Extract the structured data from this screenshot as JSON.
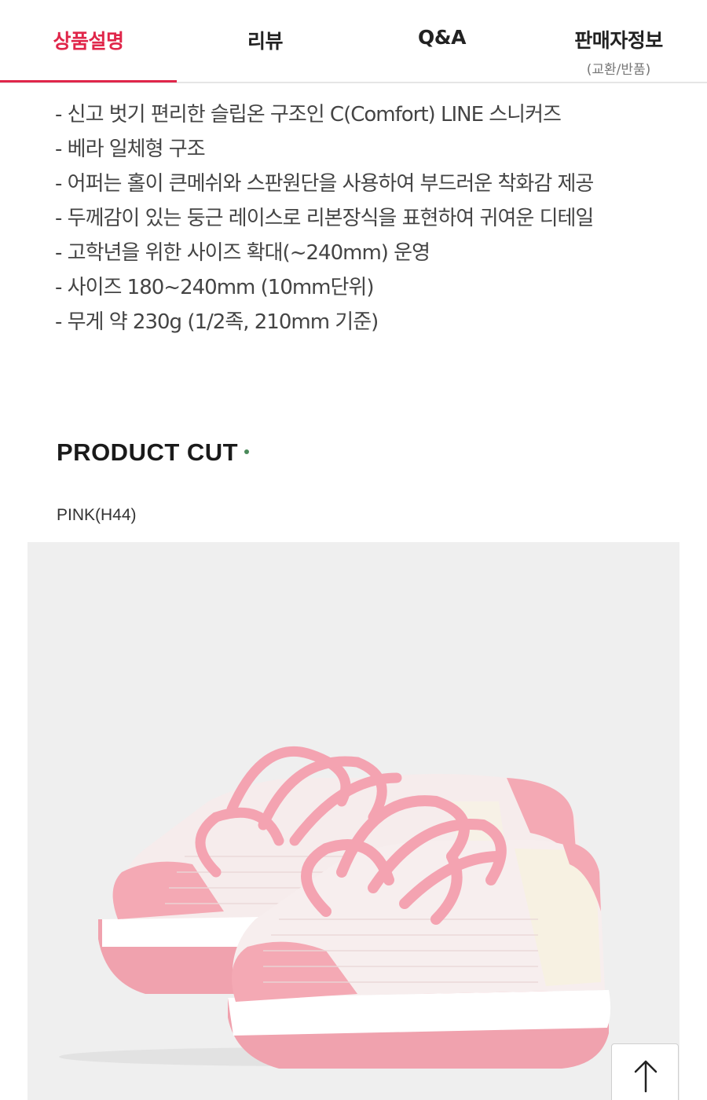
{
  "tabs": [
    {
      "label": "상품설명",
      "sub": "",
      "active": true
    },
    {
      "label": "리뷰",
      "sub": "",
      "active": false
    },
    {
      "label": "Q&A",
      "sub": "",
      "active": false
    },
    {
      "label": "판매자정보",
      "sub": "(교환/반품)",
      "active": false
    }
  ],
  "description": [
    "- 신고 벗기 편리한 슬립온 구조인 C(Comfort) LINE 스니커즈",
    "- 베라 일체형 구조",
    "- 어퍼는 홀이 큰메쉬와 스판원단을 사용하여 부드러운 착화감 제공",
    "- 두께감이 있는 둥근 레이스로 리본장식을 표현하여 귀여운 디테일",
    "- 고학년을 위한 사이즈 확대(~240mm) 운영",
    "- 사이즈 180~240mm (10mm단위)",
    "- 무게 약 230g (1/2족, 210mm 기준)"
  ],
  "section": {
    "title": "PRODUCT CUT"
  },
  "product": {
    "color_label": "PINK(H44)"
  },
  "icons": {
    "product_image": "pink-sneaker-image",
    "scroll_top": "arrow-up-icon"
  },
  "colors": {
    "accent": "#e0264a",
    "shoe_pink": "#f4a9b4",
    "panel_bg": "#efefef"
  }
}
